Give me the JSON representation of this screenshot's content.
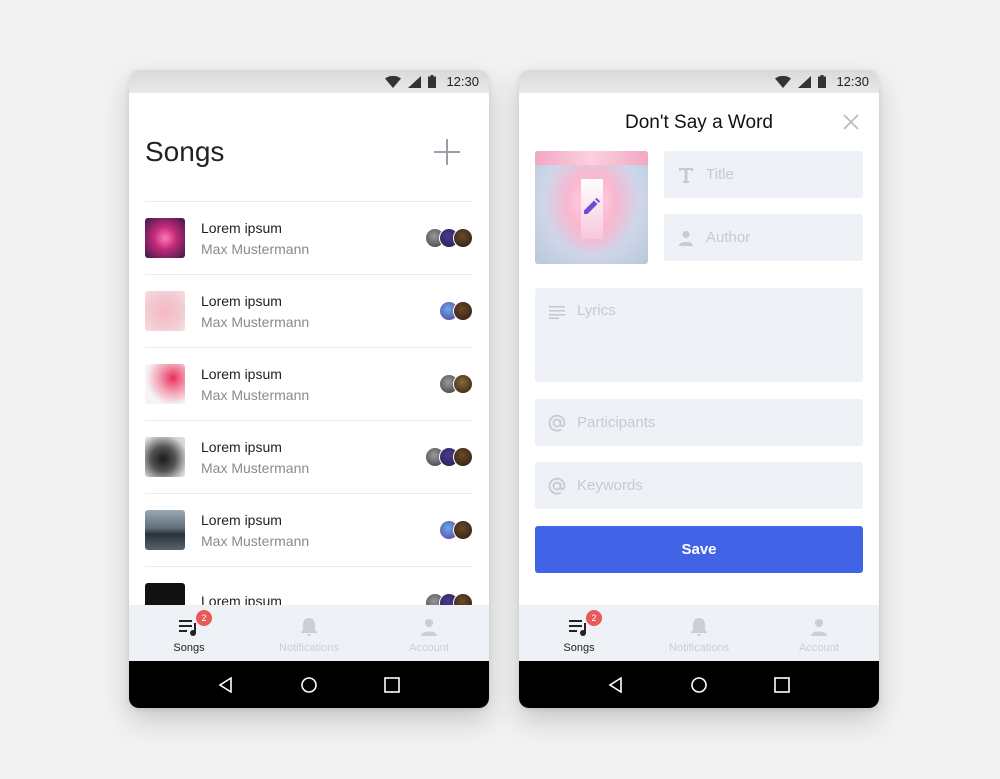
{
  "status": {
    "time": "12:30"
  },
  "songs_screen": {
    "title": "Songs",
    "rows": [
      {
        "title": "Lorem ipsum",
        "subtitle": "Max Mustermann",
        "unread": true
      },
      {
        "title": "Lorem ipsum",
        "subtitle": "Max Mustermann",
        "unread": true
      },
      {
        "title": "Lorem ipsum",
        "subtitle": "Max Mustermann",
        "unread": false
      },
      {
        "title": "Lorem ipsum",
        "subtitle": "Max Mustermann",
        "unread": false
      },
      {
        "title": "Lorem ipsum",
        "subtitle": "Max Mustermann",
        "unread": false
      },
      {
        "title": "Lorem ipsum",
        "subtitle": "",
        "unread": false
      }
    ]
  },
  "form_screen": {
    "title": "Don't Say a Word",
    "fields": {
      "title_placeholder": "Title",
      "author_placeholder": "Author",
      "lyrics_placeholder": "Lyrics",
      "participants_placeholder": "Participants",
      "keywords_placeholder": "Keywords"
    },
    "save_label": "Save"
  },
  "tabs": {
    "songs": "Songs",
    "songs_badge": "2",
    "notifications": "Notifications",
    "account": "Account"
  },
  "colors": {
    "accent": "#4164e7",
    "badge": "#e85a5a",
    "field_bg": "#eef1f6",
    "unread_dot": "#e88080"
  }
}
